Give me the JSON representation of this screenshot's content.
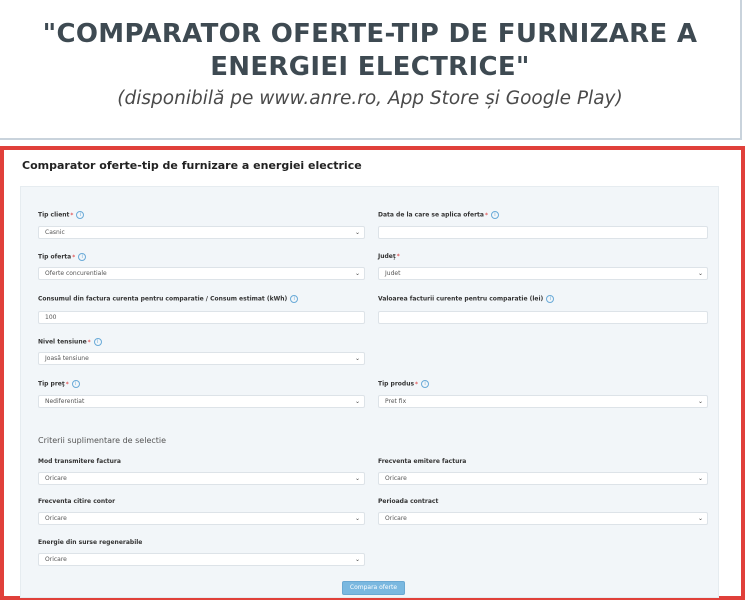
{
  "banner": {
    "title_line1": "\"COMPARATOR OFERTE-TIP DE FURNIZARE A",
    "title_line2": "ENERGIEI ELECTRICE\"",
    "subtitle": "(disponibilă pe www.anre.ro, App Store și Google Play)"
  },
  "form": {
    "title": "Comparator oferte-tip de furnizare a energiei electrice",
    "fields": {
      "tip_client": {
        "label": "Tip client",
        "value": "Casnic"
      },
      "data_oferta": {
        "label": "Data de la care se aplica oferta",
        "value": ""
      },
      "tip_oferta": {
        "label": "Tip oferta",
        "value": "Oferte concurentiale"
      },
      "judet": {
        "label": "Judeţ",
        "value": "Judet"
      },
      "consum": {
        "label": "Consumul din factura curenta pentru comparatie / Consum estimat (kWh)",
        "value": "100"
      },
      "valoare_factura": {
        "label": "Valoarea facturii curente pentru comparatie (lei)",
        "value": ""
      },
      "nivel_tensiune": {
        "label": "Nivel tensiune",
        "value": "Joasă tensiune"
      },
      "tip_pret": {
        "label": "Tip preţ",
        "value": "Nediferentiat"
      },
      "tip_produs": {
        "label": "Tip produs",
        "value": "Pret fix"
      }
    },
    "section_title": "Criterii suplimentare de selectie",
    "extra": {
      "mod_transmitere": {
        "label": "Mod transmitere factura",
        "value": "Oricare"
      },
      "frecventa_emitere": {
        "label": "Frecventa emitere factura",
        "value": "Oricare"
      },
      "frecventa_citire": {
        "label": "Frecventa citire contor",
        "value": "Oricare"
      },
      "perioada_contract": {
        "label": "Perioada contract",
        "value": "Oricare"
      },
      "energie_regenerabila": {
        "label": "Energie din surse regenerabile",
        "value": "Oricare"
      }
    },
    "required_mark": "*",
    "info_glyph": "i",
    "chevron_glyph": "⌄",
    "submit_label": "Compara oferte"
  }
}
